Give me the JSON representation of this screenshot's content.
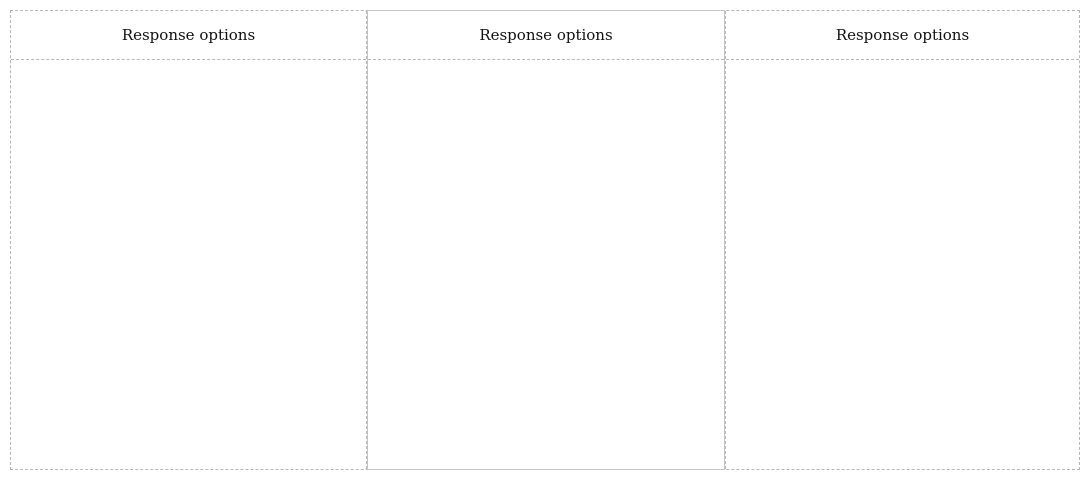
{
  "columns": [
    {
      "header": "Response options"
    },
    {
      "header": "Response options"
    },
    {
      "header": "Response options"
    }
  ]
}
